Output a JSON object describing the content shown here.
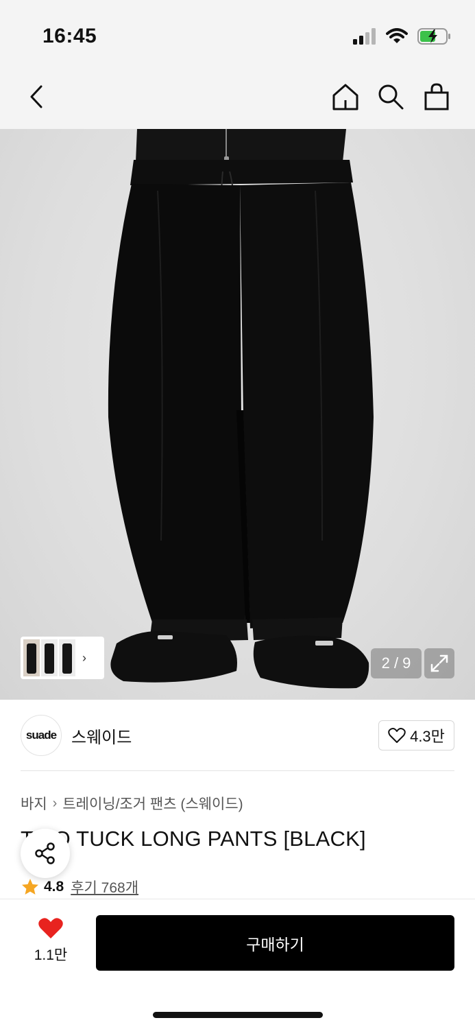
{
  "status_bar": {
    "time": "16:45"
  },
  "nav": {
    "back_icon": "chevron-left-icon",
    "home_icon": "home-icon",
    "search_icon": "search-icon",
    "cart_icon": "shopping-bag-icon"
  },
  "gallery": {
    "page_indicator": "2 / 9",
    "thumbnail_arrow": "›"
  },
  "brand": {
    "logo_text": "suade",
    "name": "스웨이드",
    "likes": "4.3만"
  },
  "breadcrumb": {
    "items": [
      "바지",
      "트레이닝/조거 팬츠 (스웨이드)"
    ],
    "separator": "›"
  },
  "product": {
    "title": "TWO TUCK LONG PANTS [BLACK]",
    "rating": "4.8",
    "review_label": "후기 768개"
  },
  "bottom": {
    "wish_count": "1.1만",
    "buy_label": "구매하기",
    "wish_color": "#e8231f"
  }
}
